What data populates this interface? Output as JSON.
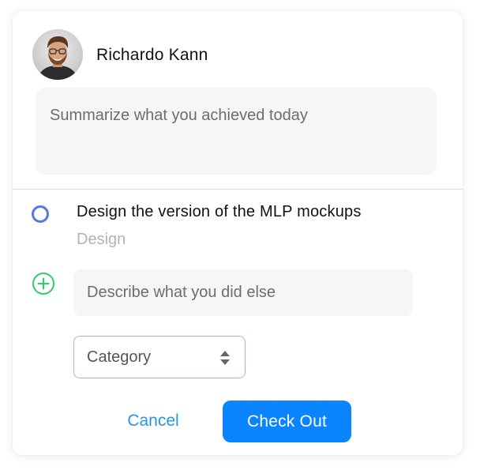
{
  "user": {
    "name": "Richardo Kann"
  },
  "summary": {
    "placeholder": "Summarize what you achieved today",
    "value": ""
  },
  "task": {
    "title": "Design the version of the MLP mockups",
    "category": "Design",
    "completed": false
  },
  "additional": {
    "placeholder": "Describe what you did else",
    "value": ""
  },
  "category_select": {
    "selected": "Category"
  },
  "actions": {
    "cancel_label": "Cancel",
    "checkout_label": "Check Out"
  },
  "icons": {
    "avatar": "user-avatar-photo",
    "task_status": "radio-circle-icon",
    "add": "plus-circle-icon",
    "select": "updown-arrows-icon"
  },
  "colors": {
    "primary": "#0a84ff",
    "link": "#2897e3",
    "radio": "#4d7de0",
    "add": "#2ecc71",
    "muted": "#b3b3b3"
  }
}
